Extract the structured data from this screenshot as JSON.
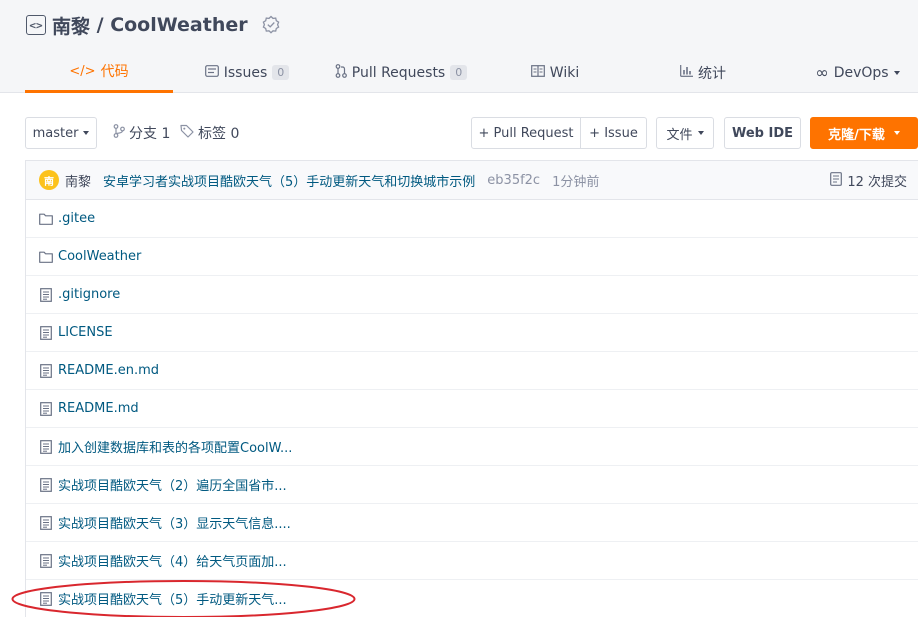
{
  "repo": {
    "owner": "南黎",
    "separator": " / ",
    "name": "CoolWeather",
    "icon": "code-bracket-icon",
    "badge_icon": "recommend-badge-icon"
  },
  "tabs": [
    {
      "label": "代码",
      "icon": "code-icon",
      "active": true
    },
    {
      "label": "Issues",
      "icon": "issues-icon",
      "count": "0"
    },
    {
      "label": "Pull Requests",
      "icon": "pull-request-icon",
      "count": "0"
    },
    {
      "label": "Wiki",
      "icon": "wiki-icon"
    },
    {
      "label": "统计",
      "icon": "chart-icon"
    },
    {
      "label": "DevOps",
      "icon": "infinity-icon"
    }
  ],
  "toolbar": {
    "branch": "master",
    "branches_label": "分支 1",
    "tags_label": "标签 0",
    "new_pr": "+ Pull Request",
    "new_issue": "+ Issue",
    "files": "文件",
    "web_ide": "Web IDE",
    "clone": "克隆/下载"
  },
  "commit": {
    "avatar_text": "南",
    "author": "南黎",
    "message": "安卓学习者实战项目酷欧天气（5）手动更新天气和切换城市示例",
    "hash": "eb35f2c",
    "time": "1分钟前",
    "count": "12 次提交"
  },
  "files": [
    {
      "name": ".gitee",
      "type": "folder"
    },
    {
      "name": "CoolWeather",
      "type": "folder"
    },
    {
      "name": ".gitignore",
      "type": "file"
    },
    {
      "name": "LICENSE",
      "type": "file"
    },
    {
      "name": "README.en.md",
      "type": "file"
    },
    {
      "name": "README.md",
      "type": "file"
    },
    {
      "name": "加入创建数据库和表的各项配置CoolW...",
      "type": "file"
    },
    {
      "name": "实战项目酷欧天气（2）遍历全国省市...",
      "type": "file"
    },
    {
      "name": "实战项目酷欧天气（3）显示天气信息....",
      "type": "file"
    },
    {
      "name": "实战项目酷欧天气（4）给天气页面加...",
      "type": "file"
    },
    {
      "name": "实战项目酷欧天气（5）手动更新天气...",
      "type": "file"
    }
  ],
  "colors": {
    "accent": "#fe7300",
    "link": "#005980",
    "annotation": "#d9272e"
  }
}
